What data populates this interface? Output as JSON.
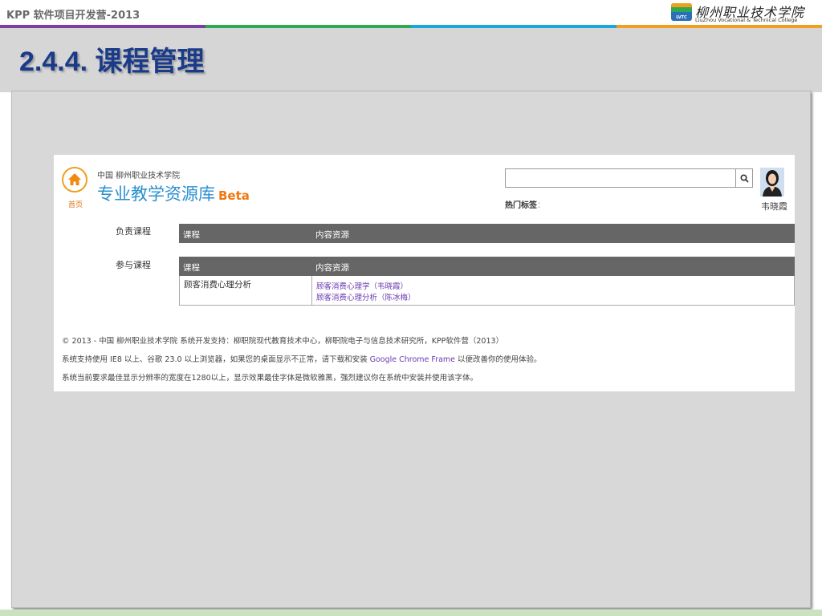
{
  "slide": {
    "course_title": "KPP 软件项目开发营-2013",
    "title": "2.4.4. 课程管理",
    "logo": {
      "cn": "柳州职业技术学院",
      "en": "LiuZhou Vocational & Technical College",
      "mark_text": "LVTC"
    },
    "colors": {
      "bar": [
        "#7b3fa0",
        "#2fa84f",
        "#1ba8d8",
        "#f0a020"
      ],
      "title": "#1a3a8a"
    }
  },
  "site": {
    "home_label": "首页",
    "org": "中国 柳州职业技术学院",
    "title": "专业教学资源库",
    "beta": "Beta",
    "search_placeholder": "",
    "search_icon": "search-icon",
    "hot_tags_label": "热门标签",
    "hot_tags_colon": "：",
    "user_name": "韦晓霞"
  },
  "responsible": {
    "label": "负责课程",
    "headers": {
      "course": "课程",
      "resources": "内容资源"
    }
  },
  "participating": {
    "label": "参与课程",
    "headers": {
      "course": "课程",
      "resources": "内容资源"
    },
    "rows": [
      {
        "course": "顾客消费心理分析",
        "resources": [
          "顾客消费心理学（韦晓霞）",
          "顾客消费心理分析（陈冰梅）"
        ]
      }
    ]
  },
  "footer": {
    "line1": "© 2013 - 中国 柳州职业技术学院    系统开发支持：柳职院现代教育技术中心，柳职院电子与信息技术研究所，KPP软件营（2013）",
    "line2_pre": "系统支持使用 IE8 以上、谷歌 23.0 以上浏览器，如果您的桌面显示不正常，请下载和安装 ",
    "line2_link": "Google Chrome Frame",
    "line2_post": " 以便改善你的使用体验。",
    "line3": "系统当前要求最佳显示分辨率的宽度在1280以上，显示效果最佳字体是微软雅黑，强烈建议你在系统中安装并使用该字体。"
  }
}
